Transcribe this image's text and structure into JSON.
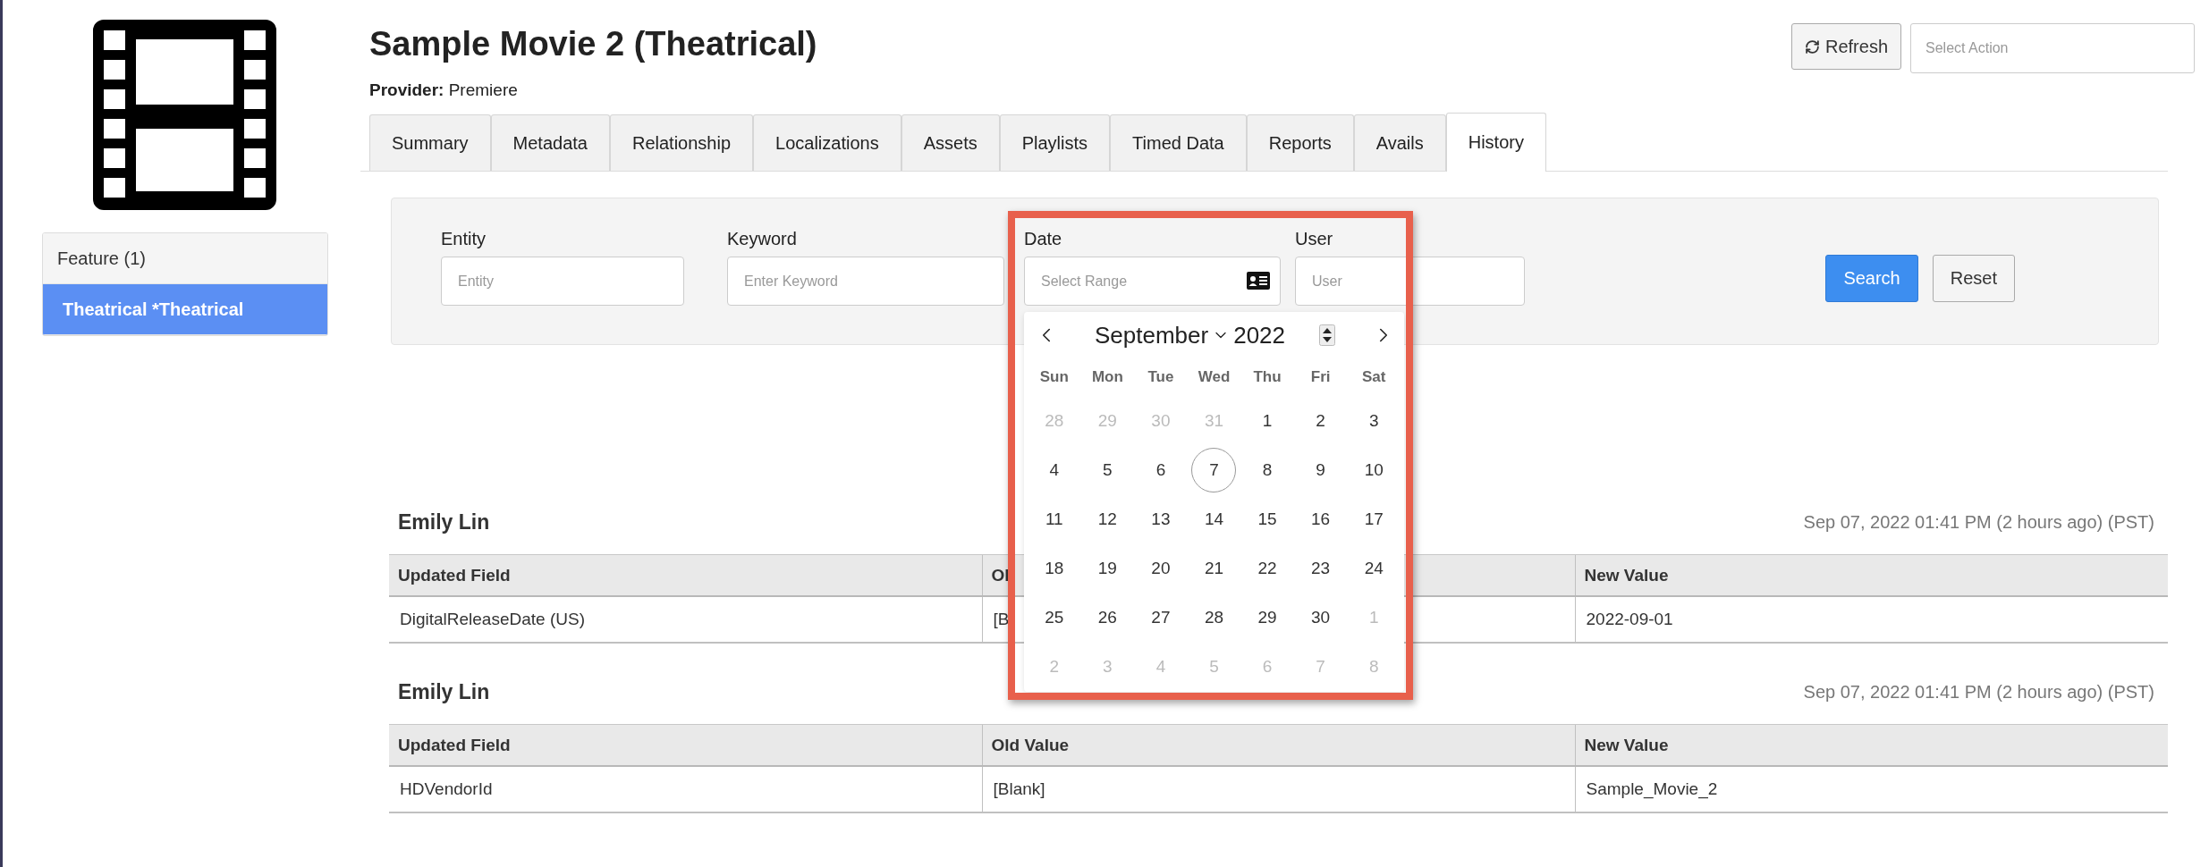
{
  "title": "Sample Movie 2 (Theatrical)",
  "provider": "**Provider:** Premiere",
  "header_actions": {
    "refresh": "Refresh",
    "action_select": {
      "placeholder": "Select Action"
    }
  },
  "sidebar": {
    "items": [
      {
        "label": "Feature (1)",
        "selected": false
      },
      {
        "label": "Theatrical *Theatrical",
        "selected": true
      }
    ]
  },
  "tabs": [
    {
      "label": "Summary",
      "selected": false
    },
    {
      "label": "Metadata",
      "selected": false
    },
    {
      "label": "Relationship",
      "selected": false
    },
    {
      "label": "Localizations",
      "selected": false
    },
    {
      "label": "Assets",
      "selected": false
    },
    {
      "label": "Playlists",
      "selected": false
    },
    {
      "label": "Timed Data",
      "selected": false
    },
    {
      "label": "Reports",
      "selected": false
    },
    {
      "label": "Avails",
      "selected": false
    },
    {
      "label": "History",
      "selected": true
    }
  ],
  "filters": {
    "fields": [
      {
        "kind": "text",
        "label": "Entity",
        "placeholder": "Entity"
      },
      {
        "kind": "text",
        "label": "Keyword",
        "placeholder": "Enter Keyword"
      },
      {
        "kind": "date",
        "label": "Date",
        "placeholder": "Select Range"
      },
      {
        "kind": "text",
        "label": "User",
        "placeholder": "User"
      }
    ],
    "buttons": [
      {
        "label": "Search",
        "primary": true
      },
      {
        "label": "Reset",
        "primary": false
      }
    ]
  },
  "calendar": {
    "month": "September",
    "year": "2022",
    "weekdays": [
      "Sun",
      "Mon",
      "Tue",
      "Wed",
      "Thu",
      "Fri",
      "Sat"
    ],
    "weeks": [
      [
        {
          "label": "28",
          "outside": true,
          "selected": false
        },
        {
          "label": "29",
          "outside": true,
          "selected": false
        },
        {
          "label": "30",
          "outside": true,
          "selected": false
        },
        {
          "label": "31",
          "outside": true,
          "selected": false
        },
        {
          "label": "1",
          "outside": false,
          "selected": false
        },
        {
          "label": "2",
          "outside": false,
          "selected": false
        },
        {
          "label": "3",
          "outside": false,
          "selected": false
        }
      ],
      [
        {
          "label": "4",
          "outside": false,
          "selected": false
        },
        {
          "label": "5",
          "outside": false,
          "selected": false
        },
        {
          "label": "6",
          "outside": false,
          "selected": false
        },
        {
          "label": "7",
          "outside": false,
          "selected": true
        },
        {
          "label": "8",
          "outside": false,
          "selected": false
        },
        {
          "label": "9",
          "outside": false,
          "selected": false
        },
        {
          "label": "10",
          "outside": false,
          "selected": false
        }
      ],
      [
        {
          "label": "11",
          "outside": false,
          "selected": false
        },
        {
          "label": "12",
          "outside": false,
          "selected": false
        },
        {
          "label": "13",
          "outside": false,
          "selected": false
        },
        {
          "label": "14",
          "outside": false,
          "selected": false
        },
        {
          "label": "15",
          "outside": false,
          "selected": false
        },
        {
          "label": "16",
          "outside": false,
          "selected": false
        },
        {
          "label": "17",
          "outside": false,
          "selected": false
        }
      ],
      [
        {
          "label": "18",
          "outside": false,
          "selected": false
        },
        {
          "label": "19",
          "outside": false,
          "selected": false
        },
        {
          "label": "20",
          "outside": false,
          "selected": false
        },
        {
          "label": "21",
          "outside": false,
          "selected": false
        },
        {
          "label": "22",
          "outside": false,
          "selected": false
        },
        {
          "label": "23",
          "outside": false,
          "selected": false
        },
        {
          "label": "24",
          "outside": false,
          "selected": false
        }
      ],
      [
        {
          "label": "25",
          "outside": false,
          "selected": false
        },
        {
          "label": "26",
          "outside": false,
          "selected": false
        },
        {
          "label": "27",
          "outside": false,
          "selected": false
        },
        {
          "label": "28",
          "outside": false,
          "selected": false
        },
        {
          "label": "29",
          "outside": false,
          "selected": false
        },
        {
          "label": "30",
          "outside": false,
          "selected": false
        },
        {
          "label": "1",
          "outside": true,
          "selected": false
        }
      ],
      [
        {
          "label": "2",
          "outside": true,
          "selected": false
        },
        {
          "label": "3",
          "outside": true,
          "selected": false
        },
        {
          "label": "4",
          "outside": true,
          "selected": false
        },
        {
          "label": "5",
          "outside": true,
          "selected": false
        },
        {
          "label": "6",
          "outside": true,
          "selected": false
        },
        {
          "label": "7",
          "outside": true,
          "selected": false
        },
        {
          "label": "8",
          "outside": true,
          "selected": false
        }
      ]
    ]
  },
  "history": [
    {
      "user": "Emily Lin",
      "time": "Sep 07, 2022 01:41 PM (2 hours ago) (PST)",
      "columns": [
        "Updated Field",
        "Ol",
        "New Value"
      ],
      "rows": [
        [
          "DigitalReleaseDate (US)",
          "[B",
          "2022-09-01"
        ]
      ]
    },
    {
      "user": "Emily Lin",
      "time": "Sep 07, 2022 01:41 PM (2 hours ago) (PST)",
      "columns": [
        "Updated Field",
        "Old Value",
        "New Value"
      ],
      "rows": [
        [
          "HDVendorId",
          "[Blank]",
          "Sample_Movie_2"
        ]
      ]
    }
  ]
}
